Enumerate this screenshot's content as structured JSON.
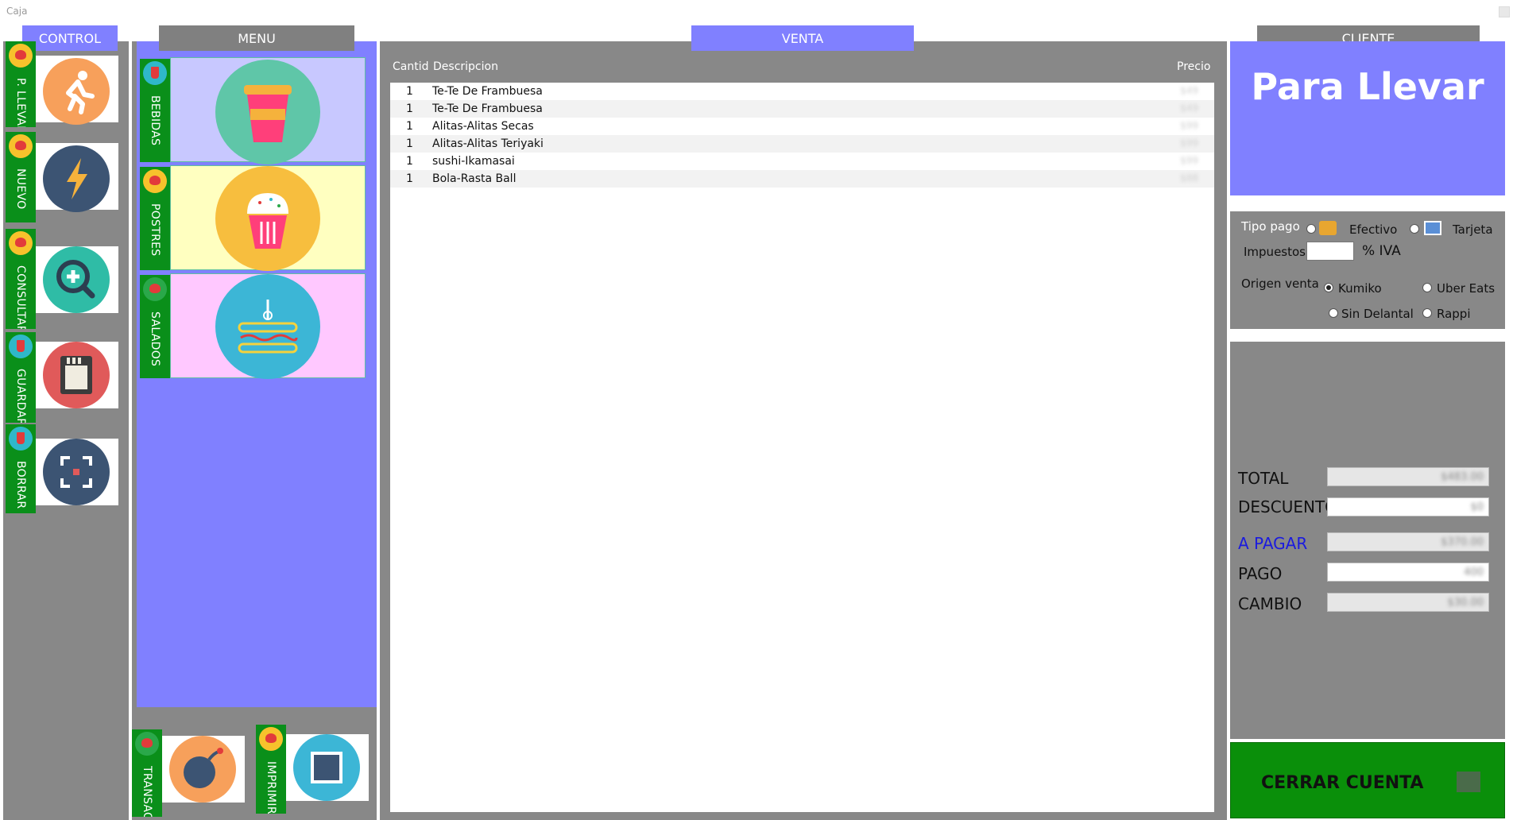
{
  "window": {
    "title": "Caja"
  },
  "headers": {
    "control": "CONTROL",
    "menu": "MENU",
    "venta": "VENTA",
    "cliente": "CLIENTE"
  },
  "control_items": [
    {
      "label": "P. LLEVAR",
      "icon": "running-person-icon"
    },
    {
      "label": "NUEVO",
      "icon": "lightning-icon"
    },
    {
      "label": "CONSULTAR",
      "icon": "zoom-plus-icon"
    },
    {
      "label": "GUARDAR",
      "icon": "sd-card-icon"
    },
    {
      "label": "BORRAR",
      "icon": "focus-frame-icon"
    }
  ],
  "menu_items": [
    {
      "label": "BEBIDAS",
      "icon": "coffee-cup-icon"
    },
    {
      "label": "POSTRES",
      "icon": "cupcake-icon"
    },
    {
      "label": "SALADOS",
      "icon": "sandwich-icon"
    }
  ],
  "bottom_actions": [
    {
      "label": "TRANSACC",
      "icon": "bomb-icon"
    },
    {
      "label": "IMPRIMIR",
      "icon": "square-icon"
    }
  ],
  "sale": {
    "col_qty": "Cantid",
    "col_desc": "Descripcion",
    "col_price": "Precio",
    "rows": [
      {
        "qty": "1",
        "desc": "Te-Te De Frambuesa",
        "price": "$49"
      },
      {
        "qty": "1",
        "desc": "Te-Te De Frambuesa",
        "price": "$49"
      },
      {
        "qty": "1",
        "desc": "Alitas-Alitas Secas",
        "price": "$99"
      },
      {
        "qty": "1",
        "desc": "Alitas-Alitas Teriyaki",
        "price": "$99"
      },
      {
        "qty": "1",
        "desc": "sushi-Ikamasai",
        "price": "$99"
      },
      {
        "qty": "1",
        "desc": "Bola-Rasta Ball",
        "price": "$88"
      }
    ]
  },
  "cliente": {
    "name": "Para Llevar"
  },
  "payment": {
    "tipo_pago_label": "Tipo pago",
    "efectivo": "Efectivo",
    "tarjeta": "Tarjeta",
    "impuestos_label": "Impuestos",
    "iva_label": "% IVA",
    "origen_label": "Origen venta",
    "origins": [
      "Kumiko",
      "Uber Eats",
      "Sin Delantal",
      "Rappi"
    ],
    "origin_selected": "Kumiko"
  },
  "totals": {
    "total_label": "TOTAL",
    "descuento_label": "DESCUENTO",
    "apagar_label": "A PAGAR",
    "pago_label": "PAGO",
    "cambio_label": "CAMBIO",
    "total_value": "$483.00",
    "descuento_value": "$0",
    "apagar_value": "$370.00",
    "pago_value": "400",
    "cambio_value": "$30.00",
    "apagar_color": "#1a1adf"
  },
  "cerrar": {
    "label": "CERRAR CUENTA"
  },
  "colors": {
    "accent_blue": "#8080ff",
    "green": "#0a8f1a",
    "panel_grey": "#888888"
  }
}
